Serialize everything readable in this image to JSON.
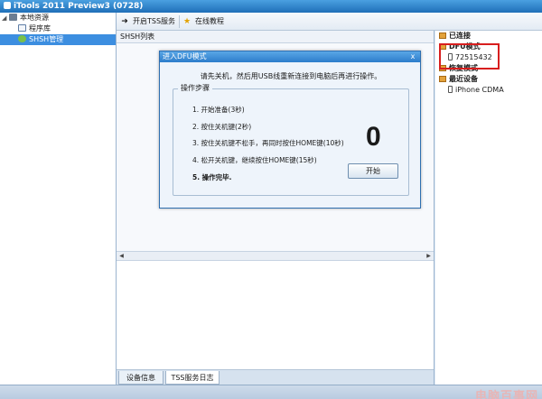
{
  "window": {
    "title": "iTools 2011 Preview3 (0728)"
  },
  "left_tree": {
    "root_label": "本地资源",
    "items": [
      {
        "label": "程序库"
      },
      {
        "label": "SHSH管理"
      }
    ]
  },
  "toolbar": {
    "start_tss_label": "开启TSS服务",
    "tutorial_label": "在线教程"
  },
  "main": {
    "list_header": "SHSH列表",
    "tabs": [
      {
        "label": "设备信息"
      },
      {
        "label": "TSS服务日志"
      }
    ]
  },
  "right_tree": {
    "categories": [
      {
        "label": "已连接"
      },
      {
        "label": "DFU模式",
        "devices": [
          {
            "label": "72515432"
          }
        ]
      },
      {
        "label": "恢复模式"
      },
      {
        "label": "最近设备",
        "devices": [
          {
            "label": "iPhone CDMA"
          }
        ]
      }
    ]
  },
  "dialog": {
    "title": "进入DFU模式",
    "close_glyph": "x",
    "message": "请先关机，然后用USB线重新连接到电脑后再进行操作。",
    "group_title": "操作步骤",
    "steps": [
      "1. 开始准备(3秒)",
      "2. 按住关机键(2秒)",
      "3. 按住关机键不松手，再同时按住HOME键(10秒)",
      "4. 松开关机键，继续按住HOME键(15秒)",
      "5. 操作完毕."
    ],
    "counter": "0",
    "start_button_label": "开始"
  },
  "colors": {
    "title_bar": "#2c7ccb",
    "selection": "#3c8ee0",
    "highlight_box": "#d81e1e"
  }
}
